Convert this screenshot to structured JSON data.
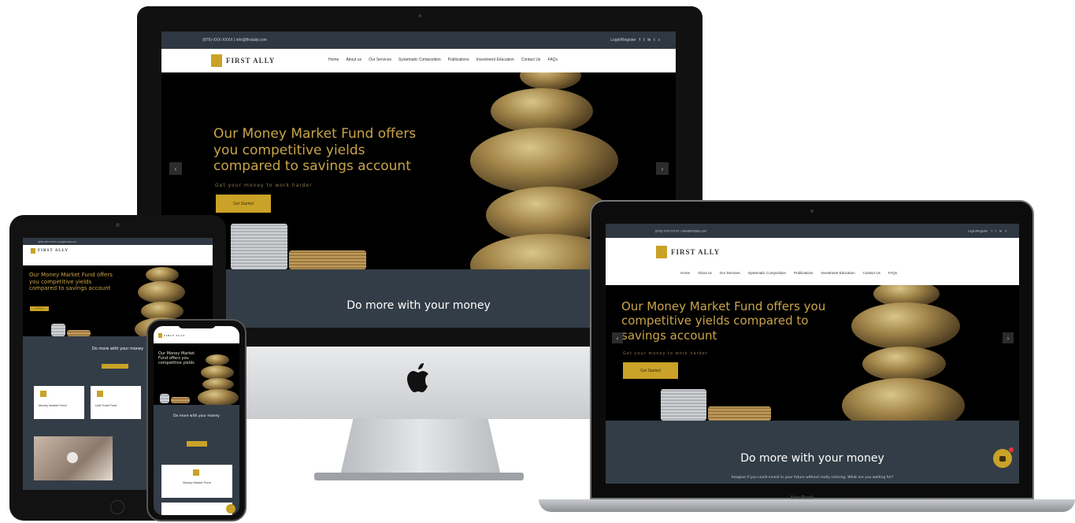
{
  "site": {
    "brand": "FIRST ALLY",
    "topbar_contact": "(876)-XXX-XXXX | info@firstally.com",
    "topbar_login": "Login/Register",
    "social_icons": [
      "facebook-icon",
      "twitter-icon",
      "linkedin-icon",
      "twitter-icon",
      "search-icon"
    ],
    "nav_items": [
      "Home",
      "About us",
      "Our Services",
      "Systematic Composition",
      "Publications",
      "Investment Education",
      "Contact Us",
      "FAQs"
    ],
    "hero_title": "Our Money Market Fund offers you competitive yields compared to savings account",
    "hero_subtitle": "Get your money to work harder",
    "cta_label": "Get Started",
    "band_title": "Do more with your money",
    "band_subtitle": "Imagine if you could invest in your future without really noticing. What are you waiting for?"
  },
  "tablet": {
    "hero_title": "Our Money Market Fund offers you competitive yields compared to savings account",
    "band_title": "Do more with your money",
    "card1": "Money Market Fund",
    "card2": "Unit Trust Fund"
  },
  "phone": {
    "hero_title": "Our Money Market Fund offers you competitive yields",
    "band_title": "Do more with your money",
    "card_title": "Money Market Fund"
  },
  "laptop": {
    "label": "MacBook"
  },
  "colors": {
    "gold": "#c9a227",
    "dark_band": "#333d47",
    "topbar": "#2f3842"
  }
}
